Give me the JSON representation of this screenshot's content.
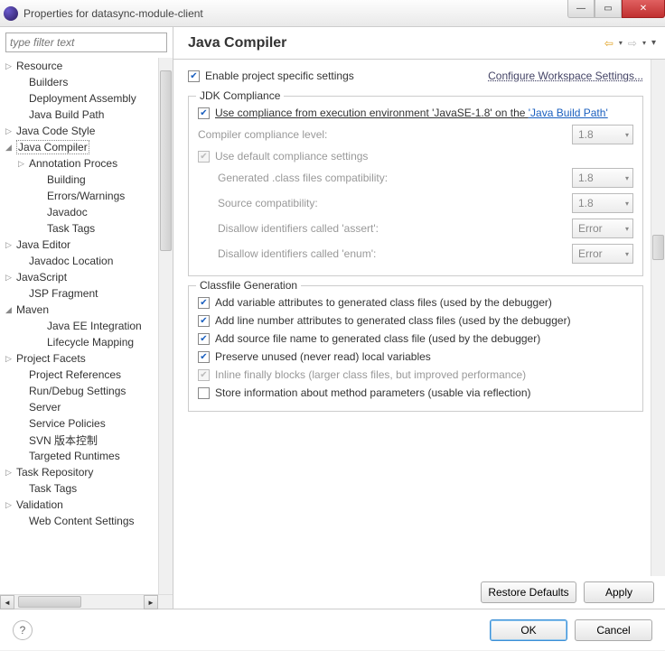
{
  "window": {
    "title": "Properties for datasync-module-client"
  },
  "filter": {
    "placeholder": "type filter text"
  },
  "nav": {
    "items": [
      {
        "label": "Resource",
        "tw": "▷",
        "depth": 0
      },
      {
        "label": "Builders",
        "tw": "",
        "depth": 1
      },
      {
        "label": "Deployment Assembly",
        "tw": "",
        "depth": 1
      },
      {
        "label": "Java Build Path",
        "tw": "",
        "depth": 1
      },
      {
        "label": "Java Code Style",
        "tw": "▷",
        "depth": 0
      },
      {
        "label": "Java Compiler",
        "tw": "◢",
        "depth": 0,
        "selected": true
      },
      {
        "label": "Annotation Proces",
        "tw": "▷",
        "depth": 1
      },
      {
        "label": "Building",
        "tw": "",
        "depth": 2
      },
      {
        "label": "Errors/Warnings",
        "tw": "",
        "depth": 2
      },
      {
        "label": "Javadoc",
        "tw": "",
        "depth": 2
      },
      {
        "label": "Task Tags",
        "tw": "",
        "depth": 2
      },
      {
        "label": "Java Editor",
        "tw": "▷",
        "depth": 0
      },
      {
        "label": "Javadoc Location",
        "tw": "",
        "depth": 1
      },
      {
        "label": "JavaScript",
        "tw": "▷",
        "depth": 0
      },
      {
        "label": "JSP Fragment",
        "tw": "",
        "depth": 1
      },
      {
        "label": "Maven",
        "tw": "◢",
        "depth": 0
      },
      {
        "label": "Java EE Integration",
        "tw": "",
        "depth": 2
      },
      {
        "label": "Lifecycle Mapping",
        "tw": "",
        "depth": 2
      },
      {
        "label": "Project Facets",
        "tw": "▷",
        "depth": 0
      },
      {
        "label": "Project References",
        "tw": "",
        "depth": 1
      },
      {
        "label": "Run/Debug Settings",
        "tw": "",
        "depth": 1
      },
      {
        "label": "Server",
        "tw": "",
        "depth": 1
      },
      {
        "label": "Service Policies",
        "tw": "",
        "depth": 1
      },
      {
        "label": "SVN 版本控制",
        "tw": "",
        "depth": 1
      },
      {
        "label": "Targeted Runtimes",
        "tw": "",
        "depth": 1
      },
      {
        "label": "Task Repository",
        "tw": "▷",
        "depth": 0
      },
      {
        "label": "Task Tags",
        "tw": "",
        "depth": 1
      },
      {
        "label": "Validation",
        "tw": "▷",
        "depth": 0
      },
      {
        "label": "Web Content Settings",
        "tw": "",
        "depth": 1
      }
    ]
  },
  "header": {
    "title": "Java Compiler"
  },
  "top": {
    "enable": "Enable project specific settings",
    "configure_link": "Configure Workspace Settings..."
  },
  "jdk": {
    "legend": "JDK Compliance",
    "use_exec_pre": "Use compliance from execution environment 'JavaSE-1.8' on the ",
    "use_exec_link": "'Java Build Path'",
    "level_label": "Compiler compliance level:",
    "level_value": "1.8",
    "use_defaults": "Use default compliance settings",
    "gen_class_label": "Generated .class files compatibility:",
    "gen_class_value": "1.8",
    "source_label": "Source compatibility:",
    "source_value": "1.8",
    "assert_label": "Disallow identifiers called 'assert':",
    "assert_value": "Error",
    "enum_label": "Disallow identifiers called 'enum':",
    "enum_value": "Error"
  },
  "classfile": {
    "legend": "Classfile Generation",
    "c1": "Add variable attributes to generated class files (used by the debugger)",
    "c2": "Add line number attributes to generated class files (used by the debugger)",
    "c3": "Add source file name to generated class file (used by the debugger)",
    "c4": "Preserve unused (never read) local variables",
    "c5": "Inline finally blocks (larger class files, but improved performance)",
    "c6": "Store information about method parameters (usable via reflection)"
  },
  "buttons": {
    "restore": "Restore Defaults",
    "apply": "Apply",
    "ok": "OK",
    "cancel": "Cancel"
  }
}
